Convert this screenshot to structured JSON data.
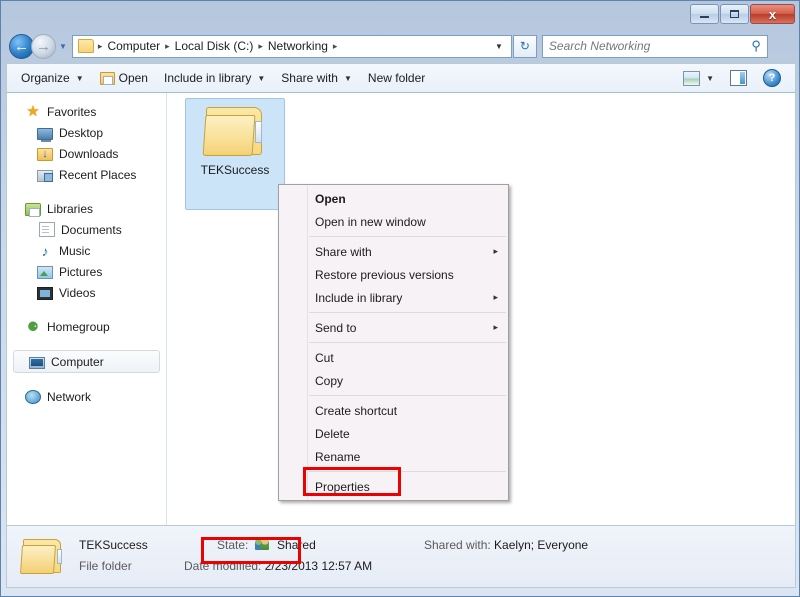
{
  "window": {
    "minimize_label": "Minimize",
    "maximize_label": "Maximize",
    "close_label": "x"
  },
  "address_bar": {
    "back_label": "←",
    "forward_label": "→",
    "history_caret": "▼",
    "dropdown_caret": "▼",
    "refresh_label": "↻",
    "separator": "▸",
    "crumbs": [
      {
        "label": "Computer"
      },
      {
        "label": "Local Disk (C:)"
      },
      {
        "label": "Networking"
      }
    ]
  },
  "search": {
    "placeholder": "Search Networking",
    "value": "",
    "icon_label": "⚲"
  },
  "toolbar": {
    "caret": "▼",
    "items": [
      {
        "label": "Organize",
        "has_caret": true,
        "has_icon": false
      },
      {
        "label": "Open",
        "has_caret": false,
        "has_icon": true
      },
      {
        "label": "Include in library",
        "has_caret": true,
        "has_icon": false
      },
      {
        "label": "Share with",
        "has_caret": true,
        "has_icon": false
      },
      {
        "label": "New folder",
        "has_caret": false,
        "has_icon": false
      }
    ],
    "help_label": "?"
  },
  "sidebar": {
    "items": [
      {
        "label": "Favorites",
        "icon": "star-icon",
        "level": "root"
      },
      {
        "label": "Desktop",
        "icon": "desktop-icon",
        "level": "child"
      },
      {
        "label": "Downloads",
        "icon": "download-icon",
        "level": "child"
      },
      {
        "label": "Recent Places",
        "icon": "recent-places-icon",
        "level": "child"
      },
      {
        "label": "Libraries",
        "icon": "library-icon",
        "level": "root"
      },
      {
        "label": "Documents",
        "icon": "document-icon",
        "level": "child"
      },
      {
        "label": "Music",
        "icon": "music-icon",
        "level": "child"
      },
      {
        "label": "Pictures",
        "icon": "pictures-icon",
        "level": "child"
      },
      {
        "label": "Videos",
        "icon": "video-icon",
        "level": "child"
      },
      {
        "label": "Homegroup",
        "icon": "homegroup-icon",
        "level": "root"
      },
      {
        "label": "Computer",
        "icon": "computer-icon",
        "level": "root",
        "selected": true
      },
      {
        "label": "Network",
        "icon": "network-icon",
        "level": "root"
      }
    ],
    "music_glyph": "♪",
    "homegroup_glyph": "⚈",
    "star_glyph": "★"
  },
  "content": {
    "files": [
      {
        "name": "TEKSuccess",
        "type": "folder",
        "selected": true
      }
    ]
  },
  "context_menu": {
    "items": [
      {
        "label": "Open",
        "bold": true,
        "submenu": false
      },
      {
        "label": "Open in new window",
        "bold": false,
        "submenu": false
      },
      {
        "separator": true
      },
      {
        "label": "Share with",
        "bold": false,
        "submenu": true
      },
      {
        "label": "Restore previous versions",
        "bold": false,
        "submenu": false
      },
      {
        "label": "Include in library",
        "bold": false,
        "submenu": true
      },
      {
        "separator": true
      },
      {
        "label": "Send to",
        "bold": false,
        "submenu": true
      },
      {
        "separator": true
      },
      {
        "label": "Cut",
        "bold": false,
        "submenu": false
      },
      {
        "label": "Copy",
        "bold": false,
        "submenu": false
      },
      {
        "separator": true
      },
      {
        "label": "Create shortcut",
        "bold": false,
        "submenu": false
      },
      {
        "label": "Delete",
        "bold": false,
        "submenu": false
      },
      {
        "label": "Rename",
        "bold": false,
        "submenu": false
      },
      {
        "separator": true
      },
      {
        "label": "Properties",
        "bold": false,
        "submenu": false,
        "highlighted": true
      }
    ],
    "submenu_arrow": "▸"
  },
  "status_bar": {
    "name": "TEKSuccess",
    "type": "File folder",
    "state_label": "State:",
    "state_value": "Shared",
    "date_label": "Date modified:",
    "date_value": "2/23/2013 12:57 AM",
    "shared_with_label": "Shared with:",
    "shared_with_value": "Kaelyn; Everyone"
  },
  "annotations": {
    "highlight_color": "#ed0000",
    "boxes": [
      {
        "target": "Properties"
      },
      {
        "target": "State: Shared"
      }
    ]
  }
}
